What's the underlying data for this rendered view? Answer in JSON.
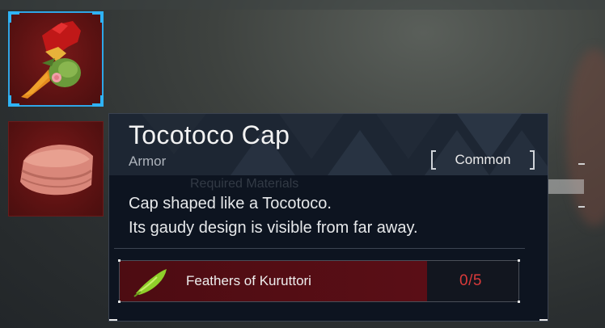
{
  "item": {
    "name": "Tocotoco Cap",
    "category": "Armor",
    "rarity": "Common",
    "description_lines": [
      "Cap shaped like a Tocotoco.",
      "Its gaudy design is visible from far away."
    ]
  },
  "background_text": "Required Materials",
  "materials": [
    {
      "name": "Feathers of Kuruttori",
      "count": "0/5",
      "icon": "feather-icon"
    }
  ],
  "slots": [
    {
      "icon": "tocotoco-cap-icon",
      "selected": true
    },
    {
      "icon": "cloth-icon",
      "selected": false
    }
  ],
  "colors": {
    "selection": "#2fa6e6",
    "slot_bg": "#5c1212",
    "tooltip_bg": "#0d1420",
    "insufficient": "#d93a3a"
  }
}
